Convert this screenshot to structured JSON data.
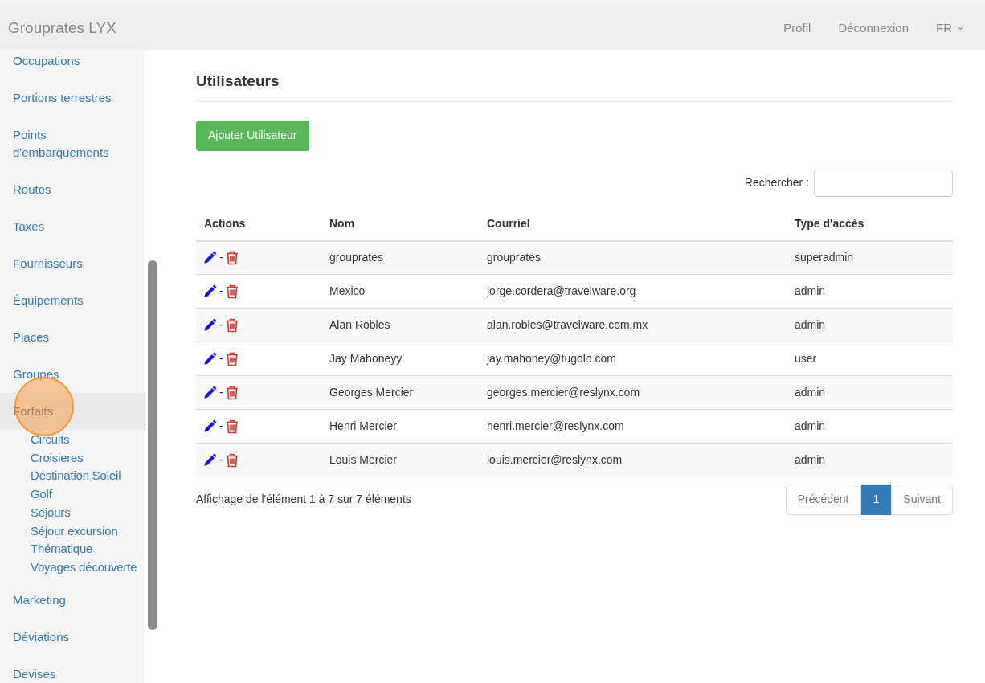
{
  "navbar": {
    "brand": "Grouprates LYX",
    "links": [
      "Profil",
      "Déconnexion"
    ],
    "language": "FR"
  },
  "sidebar": {
    "items": [
      {
        "label": "Occupations",
        "selected": false
      },
      {
        "label": "Portions terrestres",
        "selected": false
      },
      {
        "label": "Points d'embarquements",
        "selected": false
      },
      {
        "label": "Routes",
        "selected": false
      },
      {
        "label": "Taxes",
        "selected": false
      },
      {
        "label": "Fournisseurs",
        "selected": false
      },
      {
        "label": "Équipements",
        "selected": false
      },
      {
        "label": "Places",
        "selected": false
      },
      {
        "label": "Groupes",
        "selected": false
      },
      {
        "label": "Forfaits",
        "selected": true,
        "children": [
          "Circuits",
          "Croisieres",
          "Destination Soleil",
          "Golf",
          "Sejours",
          "Séjour excursion",
          "Thématique",
          "Voyages découverte"
        ]
      },
      {
        "label": "Marketing",
        "selected": false
      },
      {
        "label": "Déviations",
        "selected": false
      },
      {
        "label": "Devises",
        "selected": false
      }
    ]
  },
  "page": {
    "title": "Utilisateurs",
    "add_button": "Ajouter Utilisateur",
    "search_label": "Rechercher :",
    "table": {
      "columns": [
        "Actions",
        "Nom",
        "Courriel",
        "Type d'accès"
      ],
      "separator": "-",
      "rows": [
        {
          "name": "grouprates",
          "email": "grouprates",
          "access": "superadmin"
        },
        {
          "name": "Mexico",
          "email": "jorge.cordera@travelware.org",
          "access": "admin"
        },
        {
          "name": "Alan Robles",
          "email": "alan.robles@travelware.com.mx",
          "access": "admin"
        },
        {
          "name": "Jay Mahoneyy",
          "email": "jay.mahoney@tugolo.com",
          "access": "user"
        },
        {
          "name": "Georges Mercier",
          "email": "georges.mercier@reslynx.com",
          "access": "admin"
        },
        {
          "name": "Henri Mercier",
          "email": "henri.mercier@reslynx.com",
          "access": "admin"
        },
        {
          "name": "Louis Mercier",
          "email": "louis.mercier@reslynx.com",
          "access": "admin"
        }
      ]
    },
    "info": "Affichage de l'élément 1 à 7 sur 7 éléments",
    "pagination": {
      "previous": "Précédent",
      "pages": [
        {
          "label": "1",
          "selected": true
        }
      ],
      "next": "Suivant"
    }
  }
}
